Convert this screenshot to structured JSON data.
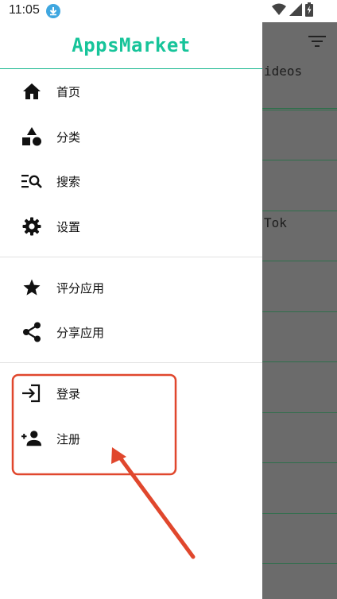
{
  "status_bar": {
    "time": "11:05",
    "icons": [
      "download-icon",
      "wifi-icon",
      "signal-icon",
      "battery-charging-icon"
    ]
  },
  "background_app": {
    "filter_icon": "filter-icon",
    "rows": [
      {
        "text": ""
      },
      {
        "text": "ideos"
      },
      {
        "text": ""
      },
      {
        "text": ""
      },
      {
        "text": "Tok"
      },
      {
        "text": ""
      },
      {
        "text": ""
      },
      {
        "text": ""
      },
      {
        "text": ""
      },
      {
        "text": ""
      },
      {
        "text": ""
      }
    ]
  },
  "drawer": {
    "title": "AppsMarket",
    "title_color": "#17c49a",
    "groups": [
      {
        "items": [
          {
            "label": "首页",
            "icon": "home-icon"
          },
          {
            "label": "分类",
            "icon": "category-icon"
          },
          {
            "label": "搜索",
            "icon": "search-list-icon"
          },
          {
            "label": "设置",
            "icon": "gear-icon"
          }
        ]
      },
      {
        "items": [
          {
            "label": "评分应用",
            "icon": "star-icon"
          },
          {
            "label": "分享应用",
            "icon": "share-icon"
          }
        ]
      },
      {
        "items": [
          {
            "label": "登录",
            "icon": "login-icon"
          },
          {
            "label": "注册",
            "icon": "add-person-icon"
          }
        ]
      }
    ]
  },
  "annotation": {
    "color": "#e0472d"
  }
}
